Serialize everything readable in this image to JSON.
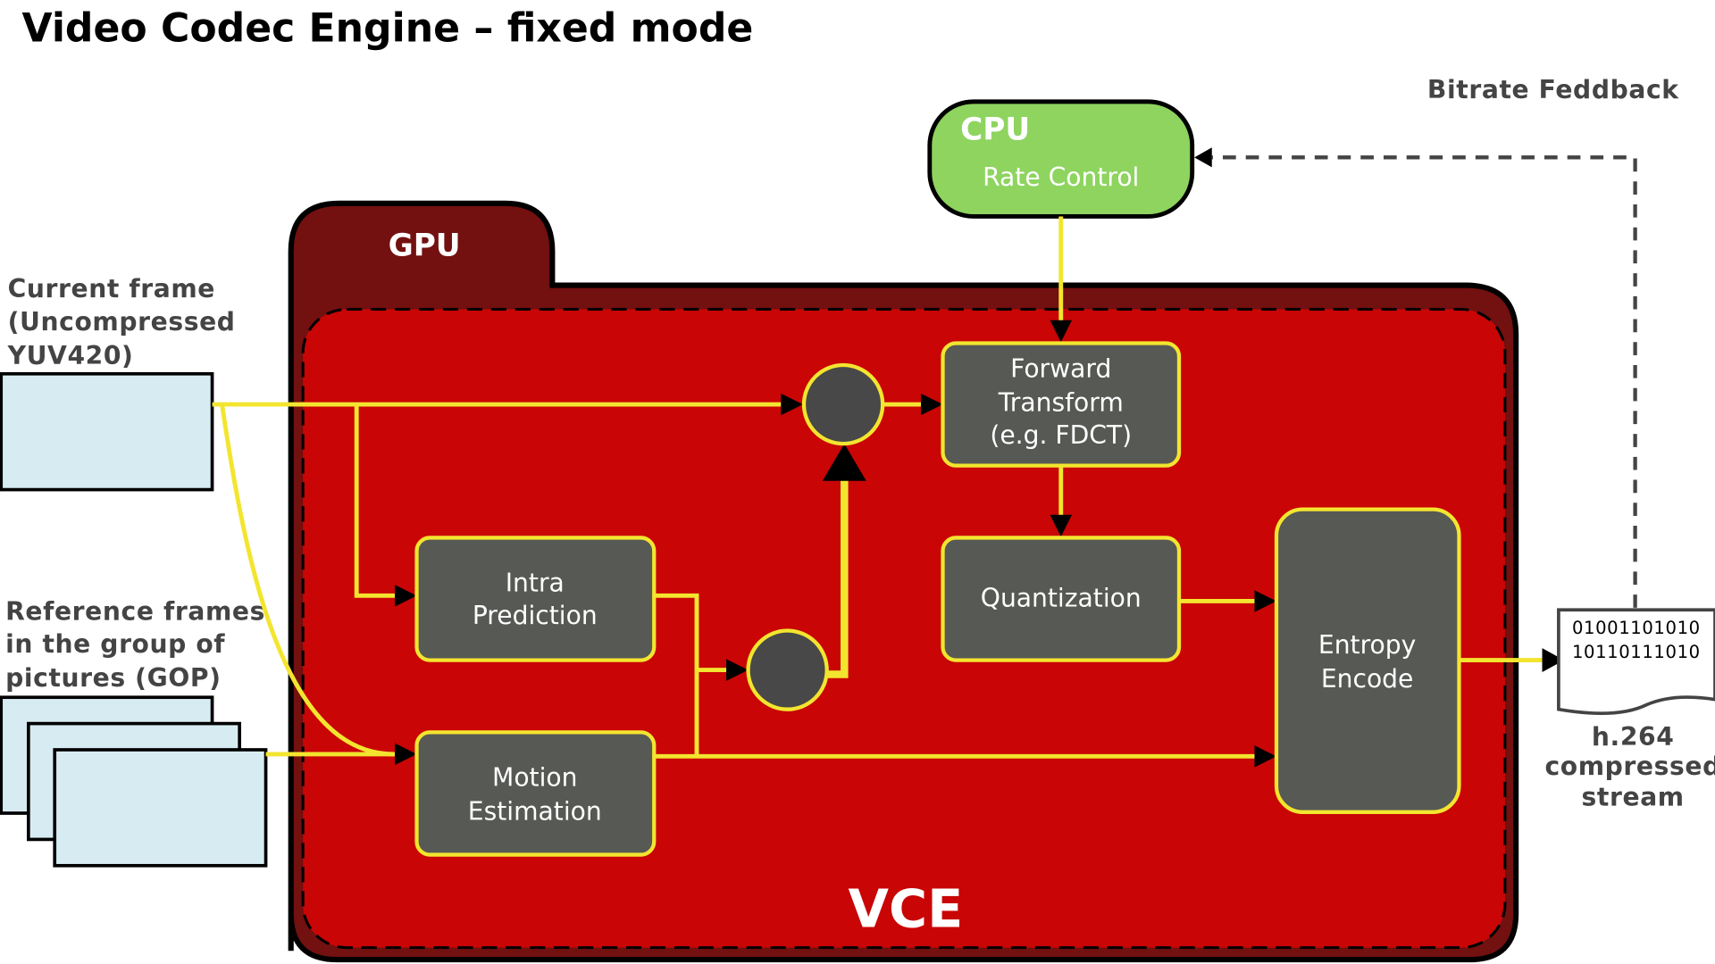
{
  "title": "Video Codec Engine – fixed mode",
  "colors": {
    "gpu_outer": "#731010",
    "vce_inner": "#c90505",
    "block_fill": "#575954",
    "wire": "#f3e52f",
    "cpu_fill": "#8ed45f",
    "frame_fill": "#d7ecf2",
    "label_text": "#444444"
  },
  "cpu": {
    "heading": "CPU",
    "label": "Rate Control"
  },
  "feedback": {
    "label": "Bitrate Feddback"
  },
  "gpu": {
    "heading": "GPU"
  },
  "vce": {
    "label": "VCE"
  },
  "inputs": {
    "current_frame": [
      "Current frame",
      "(Uncompressed",
      "YUV420)"
    ],
    "reference_frames": [
      "Reference frames",
      "in the group of",
      "pictures (GOP)"
    ]
  },
  "blocks": {
    "forward_transform": [
      "Forward",
      "Transform",
      "(e.g. FDCT)"
    ],
    "quantization": [
      "Quantization"
    ],
    "intra_prediction": [
      "Intra",
      "Prediction"
    ],
    "motion_estimation": [
      "Motion",
      "Estimation"
    ],
    "entropy_encode": [
      "Entropy",
      "Encode"
    ]
  },
  "output": {
    "bits": [
      "01001101010",
      "10110111010"
    ],
    "label": [
      "h.264",
      "compressed",
      "stream"
    ]
  }
}
